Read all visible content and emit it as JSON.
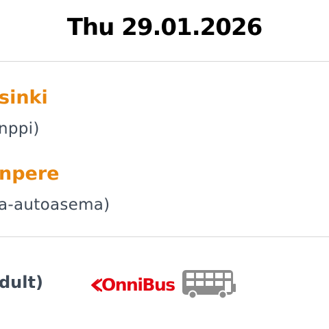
{
  "header": {
    "date": "Thu 29.01.2026"
  },
  "route": {
    "origin": {
      "city": "sinki",
      "station": "nppi)"
    },
    "destination": {
      "city": "npere",
      "station": "a-autoasema)"
    }
  },
  "ticket": {
    "fare_type": "dult)"
  },
  "operator": {
    "name": "OnniBus",
    "brand_color": "#e30613",
    "icon": "double-decker-bus-icon"
  },
  "colors": {
    "accent": "#e8860e",
    "text_secondary": "#3f4a57",
    "divider": "#d6d6d6"
  }
}
